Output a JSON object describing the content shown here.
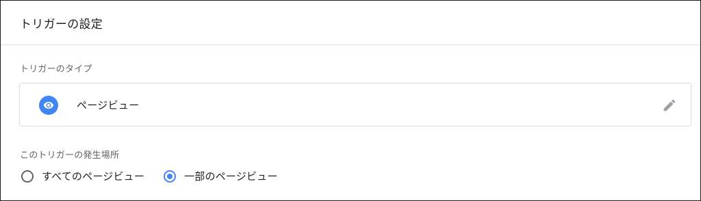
{
  "header": {
    "title": "トリガーの設定"
  },
  "trigger_type": {
    "section_label": "トリガーのタイプ",
    "name": "ページビュー",
    "icon": "eye-icon",
    "edit_icon": "pencil-icon",
    "accent_color": "#4285f4"
  },
  "fires_on": {
    "section_label": "このトリガーの発生場所",
    "options": [
      {
        "label": "すべてのページビュー",
        "selected": false
      },
      {
        "label": "一部のページビュー",
        "selected": true
      }
    ]
  }
}
